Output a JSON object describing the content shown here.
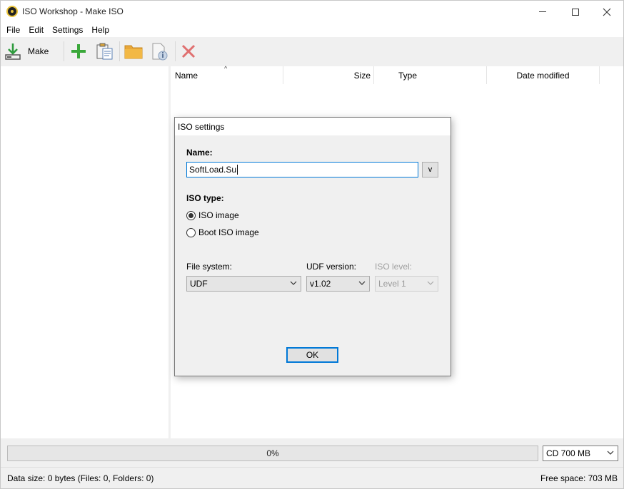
{
  "window": {
    "title": "ISO Workshop - Make ISO",
    "icon": "iso-workshop-disc-icon"
  },
  "menu": [
    "File",
    "Edit",
    "Settings",
    "Help"
  ],
  "toolbar": {
    "make_label": "Make",
    "icons": [
      "make-icon",
      "add-icon",
      "paste-icon",
      "folder-icon",
      "properties-icon",
      "delete-icon"
    ],
    "colors": {
      "add": "#3aa83a",
      "folder": "#e8a73a",
      "delete": "#e07070",
      "make_arrow": "#2e9b3e"
    }
  },
  "file_list": {
    "columns": [
      "Name",
      "Size",
      "Type",
      "Date modified"
    ],
    "sort_indicator": "^"
  },
  "progress": {
    "value": 0,
    "text": "0%"
  },
  "media_size": {
    "selected": "CD 700 MB"
  },
  "status": {
    "data_size": "Data size: 0 bytes (Files: 0, Folders: 0)",
    "free_space": "Free space: 703 MB"
  },
  "dialog": {
    "title": "ISO settings",
    "name_label": "Name:",
    "name_value": "SoftLoad.Su",
    "history_button": "v",
    "iso_type_label": "ISO type:",
    "iso_types": [
      {
        "label": "ISO image",
        "checked": true
      },
      {
        "label": "Boot ISO image",
        "checked": false
      }
    ],
    "file_system_label": "File system:",
    "file_system_value": "UDF",
    "udf_version_label": "UDF version:",
    "udf_version_value": "v1.02",
    "iso_level_label": "ISO level:",
    "iso_level_value": "Level 1",
    "ok_label": "OK",
    "accent_color": "#0078d7"
  }
}
